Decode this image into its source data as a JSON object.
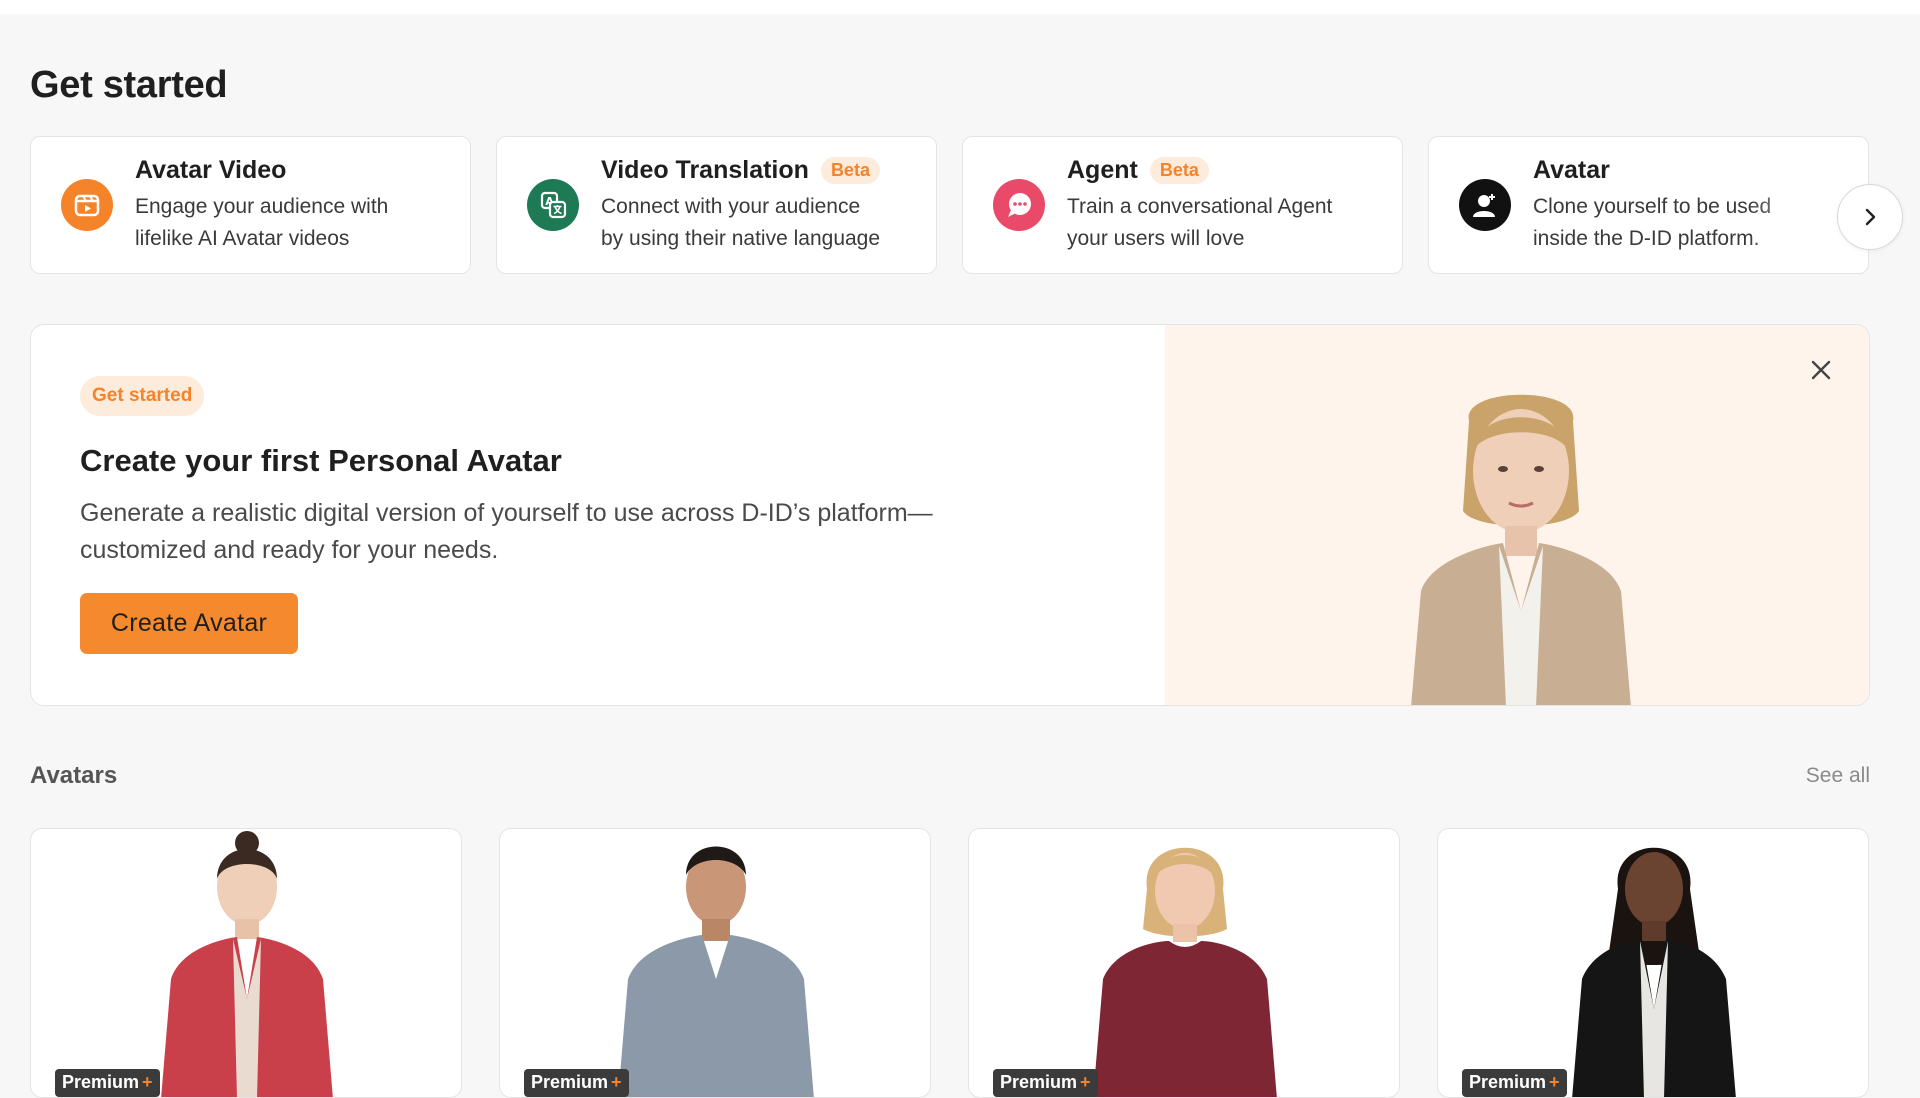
{
  "page": {
    "title": "Get started"
  },
  "features": [
    {
      "title": "Avatar Video",
      "badge": "",
      "desc_1": "Engage your audience with",
      "desc_2": "lifelike AI Avatar videos",
      "icon": "video-avatar-icon",
      "color": "#f5832a"
    },
    {
      "title": "Video Translation",
      "badge": "Beta",
      "desc_1": "Connect with your audience",
      "desc_2": "by using their native language",
      "icon": "translate-icon",
      "color": "#1e7a55"
    },
    {
      "title": "Agent",
      "badge": "Beta",
      "desc_1": "Train a conversational Agent",
      "desc_2": "your users will love",
      "icon": "chat-agent-icon",
      "color": "#e94a6a"
    },
    {
      "title": "Avatar",
      "badge": "",
      "desc_1": "Clone yourself to be used",
      "desc_2": "inside the D-ID platform.",
      "icon": "add-user-icon",
      "color": "#111111"
    }
  ],
  "banner": {
    "pill": "Get started",
    "title": "Create your first Personal Avatar",
    "desc_line1": "Generate a realistic digital version of yourself to use across D-ID’s platform—",
    "desc_line2": "customized and ready for your needs.",
    "cta": "Create Avatar",
    "accent": "#f5892d",
    "panel_bg": "#fff4ec"
  },
  "avatars": {
    "title": "Avatars",
    "see_all": "See all",
    "items": [
      {
        "badge": "Premium",
        "plus": "+",
        "outfit": "#c9404b",
        "skin": "#e8c2a8",
        "hair": "#3a2a22"
      },
      {
        "badge": "Premium",
        "plus": "+",
        "outfit": "#8c99a8",
        "skin": "#c99677",
        "hair": "#1f1a17"
      },
      {
        "badge": "Premium",
        "plus": "+",
        "outfit": "#7e2633",
        "skin": "#f0c9b0",
        "hair": "#d9b27a"
      },
      {
        "badge": "Premium",
        "plus": "+",
        "outfit": "#151515",
        "skin": "#6b4331",
        "hair": "#1a1310"
      }
    ]
  }
}
